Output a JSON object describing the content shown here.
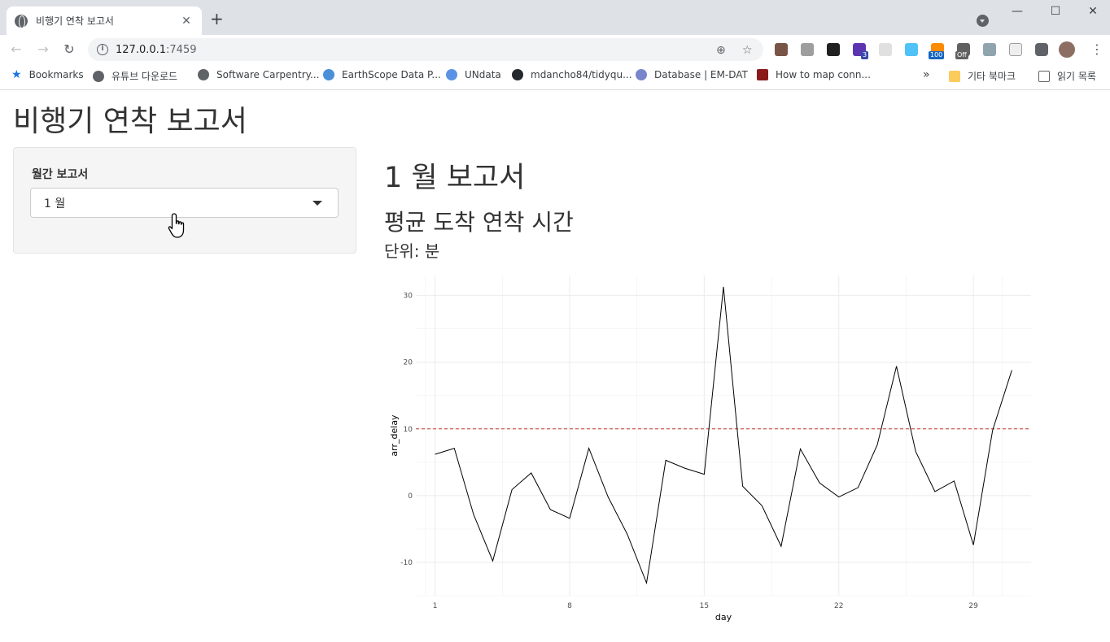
{
  "browser": {
    "tab_title": "비행기 연착 보고서",
    "tab_close": "✕",
    "new_tab": "+",
    "url_host": "127.0.0.1",
    "url_port": ":7459",
    "badges": {
      "b1": "3",
      "b2": "100",
      "b3": "Off"
    },
    "bookmarks": [
      "Bookmarks",
      "유튜브 다운로드",
      "Software Carpentry...",
      "EarthScope Data P...",
      "UNdata",
      "mdancho84/tidyqu...",
      "Database | EM-DAT",
      "How to map conn...",
      "기타 북마크",
      "읽기 목록"
    ],
    "overflow": "»"
  },
  "page": {
    "title": "비행기 연착 보고서",
    "sidebar": {
      "label": "월간 보고서",
      "selected": "1 월"
    },
    "report_title": "1 월 보고서",
    "report_subtitle": "평균 도착 연착 시간",
    "report_unit": "단위: 분"
  },
  "chart_data": {
    "type": "line",
    "xlabel": "day",
    "ylabel": "arr_delay",
    "x_ticks": [
      1,
      8,
      15,
      22,
      29
    ],
    "y_ticks": [
      -10,
      0,
      10,
      20,
      30
    ],
    "xlim": [
      0,
      32
    ],
    "ylim": [
      -15,
      33
    ],
    "grid": true,
    "reference_line": {
      "y": 10,
      "style": "dashed",
      "color": "#c0392b"
    },
    "line_color": "#000000",
    "series": [
      {
        "x": [
          1,
          2,
          3,
          4,
          5,
          6,
          7,
          8,
          9,
          10,
          11,
          12,
          13,
          14,
          15,
          16,
          17,
          18,
          19,
          20,
          21,
          22,
          23,
          24,
          25,
          26,
          27,
          28,
          29,
          30,
          31
        ],
        "y": [
          6.2,
          7.1,
          -2.8,
          -9.8,
          0.9,
          3.4,
          -2.1,
          -3.4,
          7.1,
          -0.2,
          -5.8,
          -13.1,
          5.3,
          4.1,
          3.2,
          31.3,
          1.4,
          -1.5,
          -7.6,
          7.0,
          1.9,
          -0.2,
          1.2,
          7.6,
          19.4,
          6.6,
          0.6,
          2.2,
          -7.4,
          9.8,
          18.8
        ]
      }
    ]
  }
}
